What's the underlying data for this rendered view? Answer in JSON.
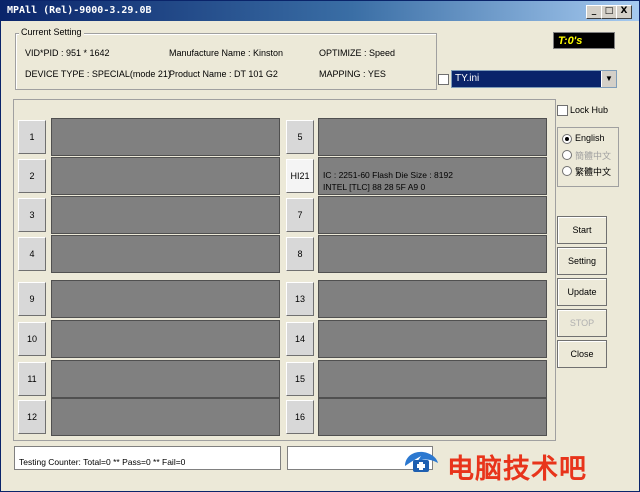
{
  "window": {
    "title": "MPAll (Rel)-9000-3.29.0B",
    "controls": [
      "_",
      "□",
      "X"
    ]
  },
  "current_setting": {
    "label": "Current Setting",
    "vid_pid": "VID*PID :  951 * 1642",
    "device_type": "DEVICE TYPE : SPECIAL(mode 21)",
    "manufacture_name": "Manufacture Name : Kinston",
    "product_name": "Product Name : DT 101 G2",
    "optimize": "OPTIMIZE : Speed",
    "mapping": "MAPPING : YES"
  },
  "timer": "T:0's",
  "ini_file": {
    "value": "TY.ini",
    "checked": false
  },
  "ports": [
    {
      "label": "1",
      "info": [
        "",
        ""
      ]
    },
    {
      "label": "2",
      "info": [
        "",
        ""
      ]
    },
    {
      "label": "3",
      "info": [
        "",
        ""
      ]
    },
    {
      "label": "4",
      "info": [
        "",
        ""
      ]
    },
    {
      "label": "9",
      "info": [
        "",
        ""
      ]
    },
    {
      "label": "10",
      "info": [
        "",
        ""
      ]
    },
    {
      "label": "11",
      "info": [
        "",
        ""
      ]
    },
    {
      "label": "12",
      "info": [
        "",
        ""
      ]
    },
    {
      "label": "5",
      "info": [
        "",
        ""
      ]
    },
    {
      "label": "HI21",
      "info": [
        "IC : 2251-60  Flash Die Size : 8192",
        "INTEL [TLC] 88 28 5F A9 0"
      ]
    },
    {
      "label": "7",
      "info": [
        "",
        ""
      ]
    },
    {
      "label": "8",
      "info": [
        "",
        ""
      ]
    },
    {
      "label": "13",
      "info": [
        "",
        ""
      ]
    },
    {
      "label": "14",
      "info": [
        "",
        ""
      ]
    },
    {
      "label": "15",
      "info": [
        "",
        ""
      ]
    },
    {
      "label": "16",
      "info": [
        "",
        ""
      ]
    }
  ],
  "lock_hub": {
    "label": "Lock Hub",
    "checked": false
  },
  "languages": [
    {
      "label": "English",
      "selected": true,
      "enabled": true
    },
    {
      "label": "簡體中文",
      "selected": false,
      "enabled": false
    },
    {
      "label": "繁體中文",
      "selected": false,
      "enabled": true
    }
  ],
  "actions": {
    "start": "Start",
    "setting": "Setting",
    "update": "Update",
    "stop": "STOP",
    "close": "Close"
  },
  "status": {
    "counter": "Testing Counter: Total=0 ** Pass=0 ** Fail=0",
    "second": ""
  },
  "watermark": {
    "text": "电脑技术吧",
    "color": "#e8341b"
  }
}
